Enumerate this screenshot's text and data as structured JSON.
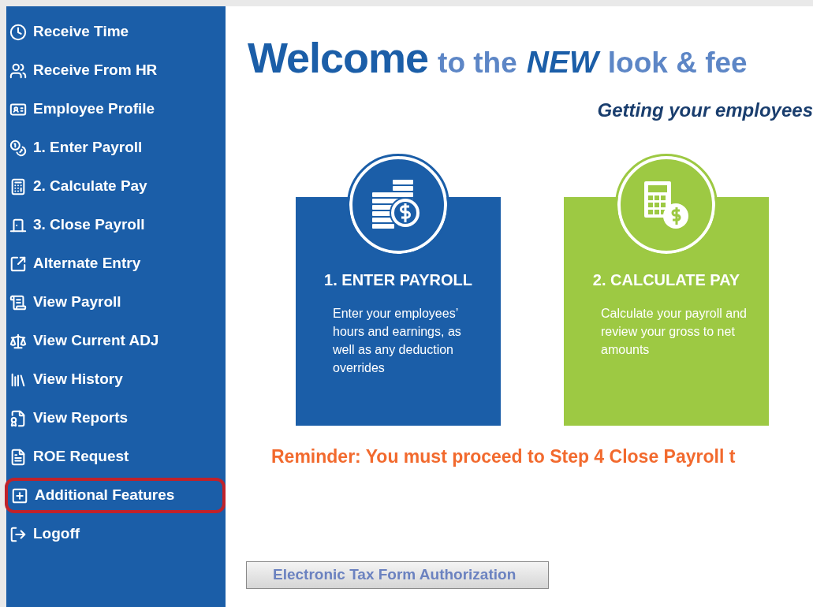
{
  "sidebar": {
    "items": [
      {
        "label": "Receive Time",
        "highlighted": false
      },
      {
        "label": "Receive From HR",
        "highlighted": false
      },
      {
        "label": "Employee Profile",
        "highlighted": false
      },
      {
        "label": "1. Enter Payroll",
        "highlighted": false
      },
      {
        "label": "2. Calculate Pay",
        "highlighted": false
      },
      {
        "label": "3. Close Payroll",
        "highlighted": false
      },
      {
        "label": "Alternate Entry",
        "highlighted": false
      },
      {
        "label": "View Payroll",
        "highlighted": false
      },
      {
        "label": "View Current ADJ",
        "highlighted": false
      },
      {
        "label": "View History",
        "highlighted": false
      },
      {
        "label": "View Reports",
        "highlighted": false
      },
      {
        "label": "ROE Request",
        "highlighted": false
      },
      {
        "label": "Additional Features",
        "highlighted": true
      },
      {
        "label": "Logoff",
        "highlighted": false
      }
    ]
  },
  "headline": [
    {
      "text": "Welcome",
      "kind": "strong"
    },
    {
      "text": "to the",
      "kind": "light"
    },
    {
      "text": "NEW",
      "kind": "emphasis"
    },
    {
      "text": "look & fee",
      "kind": "light"
    }
  ],
  "subtitle": "Getting your employees",
  "steps": [
    {
      "title": "1. ENTER PAYROLL",
      "text": "Enter your employees’ hours and earnings, as well as any deduction overrides",
      "color": "#1b5ea8"
    },
    {
      "title": "2. CALCULATE PAY",
      "text": "Calculate your payroll and review your gross to net amounts",
      "color": "#9dc943"
    }
  ],
  "reminder": "Reminder: You must proceed to Step 4 Close Payroll t",
  "button": "Electronic Tax Form Authorization"
}
